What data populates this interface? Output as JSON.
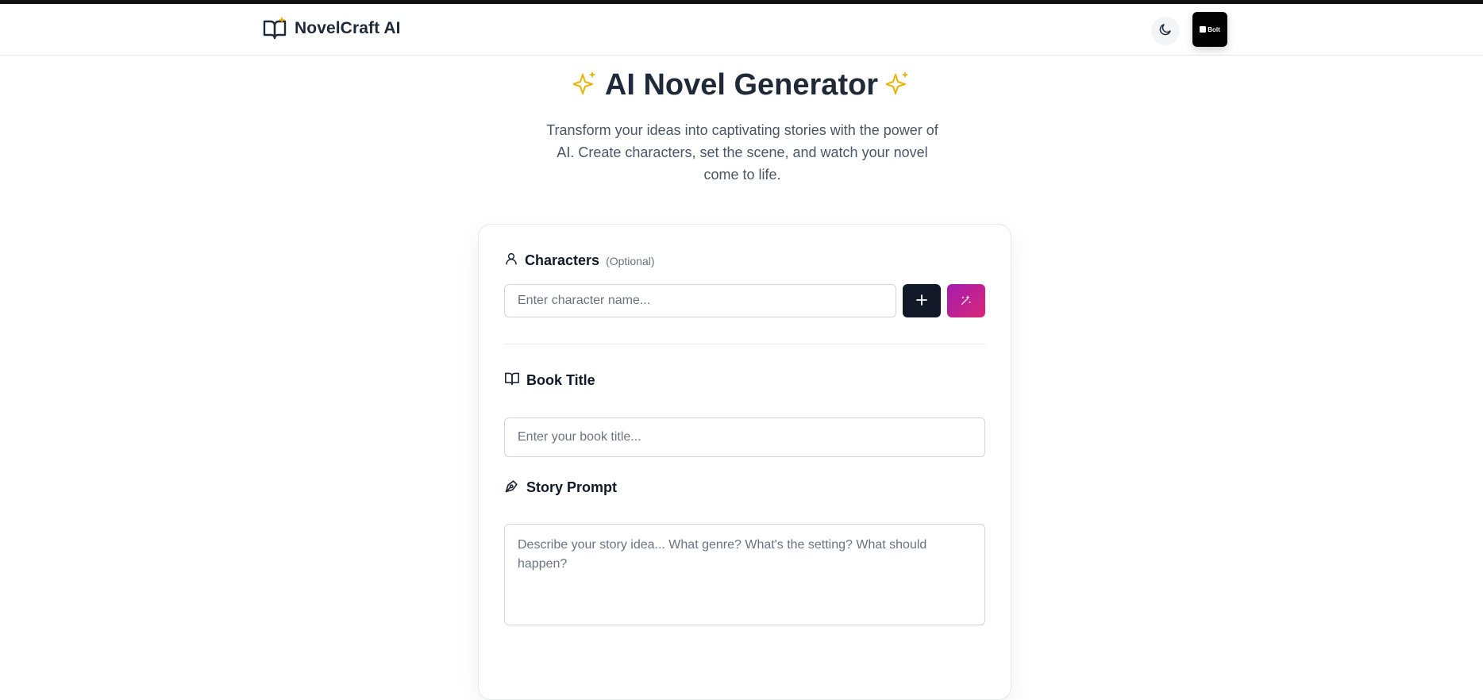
{
  "header": {
    "brand_name": "NovelCraft AI",
    "theme_toggle_icon": "moon-icon",
    "badge_label": "Bolt"
  },
  "hero": {
    "title": "AI Novel Generator",
    "subtitle": "Transform your ideas into captivating stories with the power of AI. Create characters, set the scene, and watch your novel come to life.",
    "sparkle_color": "#eab308"
  },
  "form": {
    "characters": {
      "label": "Characters",
      "optional_tag": "(Optional)",
      "icon": "user-icon",
      "input_placeholder": "Enter character name...",
      "input_value": "",
      "add_button_icon": "plus-icon",
      "generate_button_icon": "wand-sparkles-icon"
    },
    "book_title": {
      "label": "Book Title",
      "icon": "book-open-icon",
      "input_placeholder": "Enter your book title...",
      "input_value": ""
    },
    "story_prompt": {
      "label": "Story Prompt",
      "icon": "pen-tool-icon",
      "input_placeholder": "Describe your story idea... What genre? What's the setting? What should happen?",
      "input_value": ""
    }
  },
  "colors": {
    "primary_dark": "#111827",
    "magic_gradient_start": "#a21caf",
    "magic_gradient_end": "#db2777",
    "sparkle": "#eab308"
  }
}
